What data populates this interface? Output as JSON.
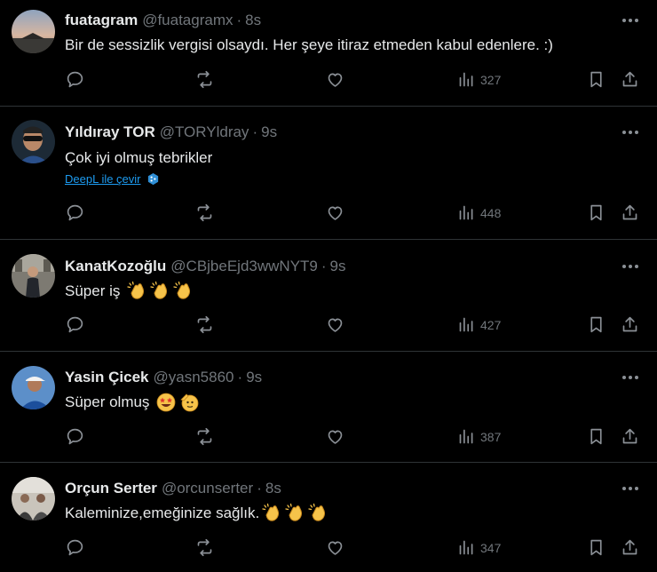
{
  "tweets": [
    {
      "name": "fuatagram",
      "handle": "@fuatagramx",
      "separator": "·",
      "time": "8s",
      "text": "Bir de sessizlik vergisi olsaydı. Her şeye itiraz etmeden kabul edenlere. :)",
      "views": "327",
      "avatar_icon": "sunset-avatar-icon"
    },
    {
      "name": "Yıldıray TOR",
      "handle": "@TORYldray",
      "separator": "·",
      "time": "9s",
      "text": "Çok iyi olmuş tebrikler",
      "translate_label": "DeepL ile çevir",
      "views": "448",
      "avatar_icon": "person-sunglasses-avatar-icon"
    },
    {
      "name": "KanatKozoğlu",
      "handle": "@CBjbeEjd3wwNYT9",
      "separator": "·",
      "time": "9s",
      "text": "Süper iş",
      "emojis": [
        "clapping-hands-icon",
        "clapping-hands-icon",
        "clapping-hands-icon"
      ],
      "views": "427",
      "avatar_icon": "person-standing-avatar-icon"
    },
    {
      "name": "Yasin Çicek",
      "handle": "@yasn5860",
      "separator": "·",
      "time": "9s",
      "text": "Süper olmuş",
      "emojis": [
        "star-struck-face-icon",
        "saluting-face-icon"
      ],
      "views": "387",
      "avatar_icon": "person-cap-avatar-icon"
    },
    {
      "name": "Orçun Serter",
      "handle": "@orcunserter",
      "separator": "·",
      "time": "8s",
      "text": "Kaleminize,emeğinize sağlık.",
      "emojis": [
        "clapping-hands-icon",
        "clapping-hands-icon",
        "clapping-hands-icon"
      ],
      "views": "347",
      "avatar_icon": "group-photo-avatar-icon"
    }
  ],
  "colors": {
    "background": "#000000",
    "text": "#e7e9ea",
    "secondary": "#71767b",
    "link": "#1d9bf0",
    "divider": "#2f3336"
  }
}
